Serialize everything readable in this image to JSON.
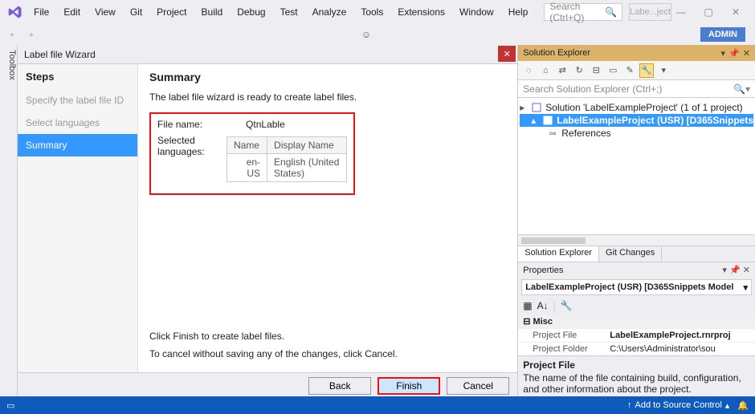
{
  "menu": [
    "File",
    "Edit",
    "View",
    "Git",
    "Project",
    "Build",
    "Debug",
    "Test",
    "Analyze",
    "Tools",
    "Extensions",
    "Window",
    "Help"
  ],
  "search_placeholder": "Search (Ctrl+Q)",
  "tab_pill": "Labe...ject",
  "admin_badge": "ADMIN",
  "toolbox_label": "Toolbox",
  "wizard": {
    "title": "Label file Wizard",
    "steps_header": "Steps",
    "steps": [
      "Specify the label file ID",
      "Select languages",
      "Summary"
    ],
    "active_step_index": 2,
    "summary_header": "Summary",
    "ready_text": "The label file wizard is ready to create label files.",
    "file_name_label": "File name:",
    "file_name_value": "QtnLable",
    "sel_lang_label": "Selected languages:",
    "lang_table": {
      "headers": [
        "Name",
        "Display Name"
      ],
      "rows": [
        [
          "en-US",
          "English (United States)"
        ]
      ]
    },
    "footer1": "Click Finish to create label files.",
    "footer2": "To cancel without saving any of the changes, click Cancel.",
    "buttons": {
      "back": "Back",
      "finish": "Finish",
      "cancel": "Cancel"
    }
  },
  "solution_explorer": {
    "title": "Solution Explorer",
    "search_placeholder": "Search Solution Explorer (Ctrl+;)",
    "solution_text": "Solution 'LabelExampleProject' (1 of 1 project)",
    "project_text": "LabelExampleProject (USR) [D365Snippets",
    "references_text": "References",
    "tabs": [
      "Solution Explorer",
      "Git Changes"
    ]
  },
  "properties": {
    "title": "Properties",
    "combo": "LabelExampleProject (USR) [D365Snippets Model",
    "category": "Misc",
    "rows": [
      {
        "name": "Project File",
        "value": "LabelExampleProject.rnrproj",
        "bold": true
      },
      {
        "name": "Project Folder",
        "value": "C:\\Users\\Administrator\\sou",
        "bold": false
      }
    ],
    "desc_title": "Project File",
    "desc_body": "The name of the file containing build, configuration, and other information about the project."
  },
  "statusbar": {
    "add_source": "Add to Source Control"
  }
}
